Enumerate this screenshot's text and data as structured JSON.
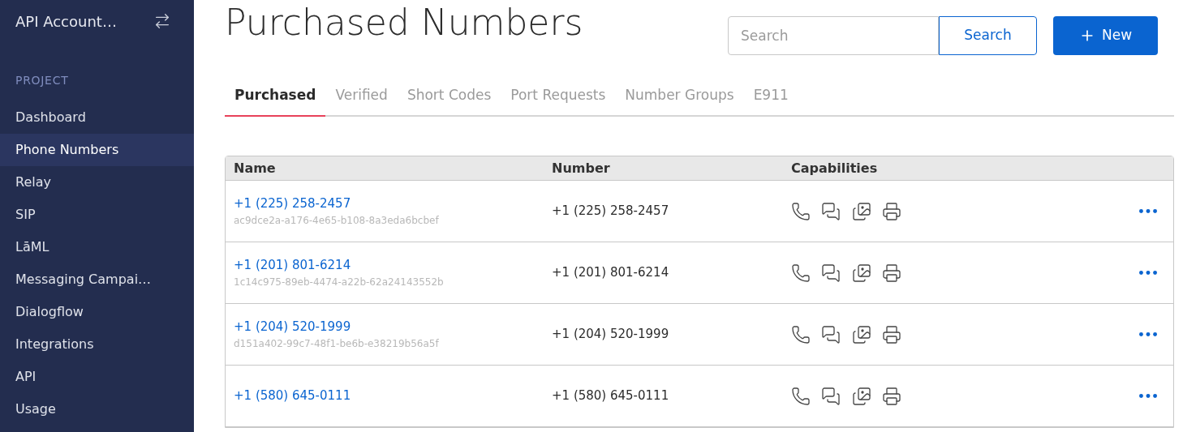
{
  "sidebar": {
    "account": "API Account…",
    "section": "PROJECT",
    "items": [
      {
        "label": "Dashboard",
        "selected": false
      },
      {
        "label": "Phone Numbers",
        "selected": true
      },
      {
        "label": "Relay",
        "selected": false
      },
      {
        "label": "SIP",
        "selected": false
      },
      {
        "label": "LāML",
        "selected": false
      },
      {
        "label": "Messaging Campai…",
        "selected": false
      },
      {
        "label": "Dialogflow",
        "selected": false
      },
      {
        "label": "Integrations",
        "selected": false
      },
      {
        "label": "API",
        "selected": false
      },
      {
        "label": "Usage",
        "selected": false
      }
    ]
  },
  "header": {
    "title": "Purchased Numbers",
    "search": {
      "placeholder": "Search"
    },
    "search_button": "Search",
    "new_button": "New"
  },
  "tabs": [
    {
      "label": "Purchased",
      "selected": true
    },
    {
      "label": "Verified",
      "selected": false
    },
    {
      "label": "Short Codes",
      "selected": false
    },
    {
      "label": "Port Requests",
      "selected": false
    },
    {
      "label": "Number Groups",
      "selected": false
    },
    {
      "label": "E911",
      "selected": false
    }
  ],
  "table": {
    "columns": [
      "Name",
      "Number",
      "Capabilities"
    ],
    "rows": [
      {
        "name": "+1 (225) 258-2457",
        "id": "ac9dce2a-a176-4e65-b108-8a3eda6bcbef",
        "number": "+1 (225) 258-2457"
      },
      {
        "name": "+1 (201) 801-6214",
        "id": "1c14c975-89eb-4474-a22b-62a24143552b",
        "number": "+1 (201) 801-6214"
      },
      {
        "name": "+1 (204) 520-1999",
        "id": "d151a402-99c7-48f1-be6b-e38219b56a5f",
        "number": "+1 (204) 520-1999"
      },
      {
        "name": "+1 (580) 645-0111",
        "number": "+1 (580) 645-0111"
      }
    ]
  }
}
